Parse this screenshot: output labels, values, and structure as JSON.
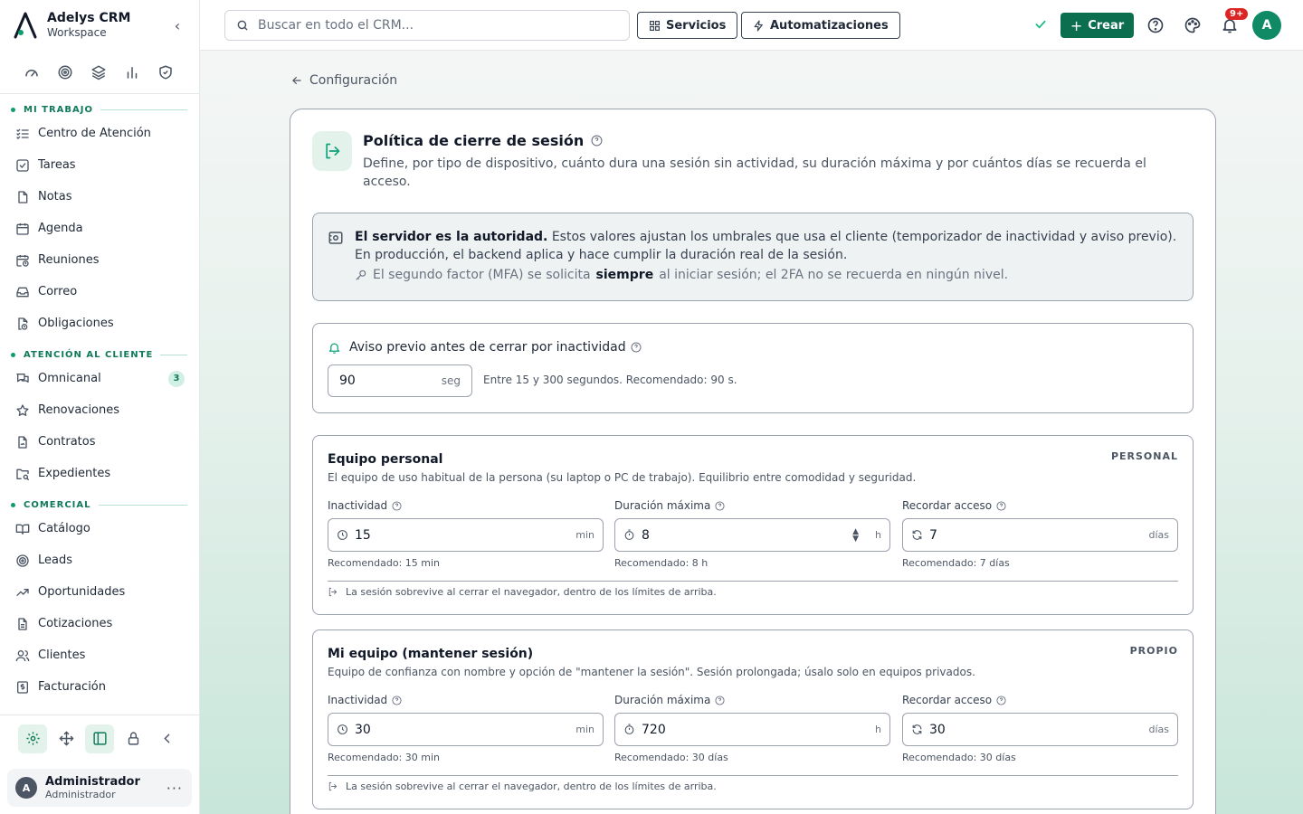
{
  "brand": {
    "app_name": "Adelys CRM",
    "workspace": "Workspace"
  },
  "sidebar": {
    "quick_icons": [
      "speedometer-icon",
      "target-icon",
      "layers-icon",
      "bar-chart-icon",
      "shield-icon"
    ],
    "sections": [
      {
        "title": "MI TRABAJO",
        "items": [
          {
            "label": "Centro de Atención",
            "icon": "list-check-icon"
          },
          {
            "label": "Tareas",
            "icon": "checkbox-icon"
          },
          {
            "label": "Notas",
            "icon": "note-icon"
          },
          {
            "label": "Agenda",
            "icon": "calendar-icon"
          },
          {
            "label": "Reuniones",
            "icon": "calendar-clock-icon"
          },
          {
            "label": "Correo",
            "icon": "inbox-icon"
          },
          {
            "label": "Obligaciones",
            "icon": "file-clock-icon"
          }
        ]
      },
      {
        "title": "ATENCIÓN AL CLIENTE",
        "items": [
          {
            "label": "Omnicanal",
            "icon": "chat-icon",
            "badge": "3"
          },
          {
            "label": "Renovaciones",
            "icon": "star-icon"
          },
          {
            "label": "Contratos",
            "icon": "file-signature-icon"
          },
          {
            "label": "Expedientes",
            "icon": "folder-search-icon"
          }
        ]
      },
      {
        "title": "COMERCIAL",
        "items": [
          {
            "label": "Catálogo",
            "icon": "book-icon"
          },
          {
            "label": "Leads",
            "icon": "target-icon"
          },
          {
            "label": "Oportunidades",
            "icon": "trend-up-icon"
          },
          {
            "label": "Cotizaciones",
            "icon": "file-text-icon"
          },
          {
            "label": "Clientes",
            "icon": "users-icon"
          },
          {
            "label": "Facturación",
            "icon": "dollar-file-icon"
          }
        ]
      }
    ],
    "tools": [
      "settings-icon",
      "move-icon",
      "panel-icon",
      "lock-icon",
      "chevron-left-icon"
    ],
    "user": {
      "initial": "A",
      "name": "Administrador",
      "role": "Administrador"
    }
  },
  "topbar": {
    "search_placeholder": "Buscar en todo el CRM...",
    "services_label": "Servicios",
    "automations_label": "Automatizaciones",
    "create_label": "Crear",
    "notif_count": "9+",
    "avatar_initial": "A"
  },
  "page": {
    "back_label": "Configuración",
    "title": "Política de cierre de sesión",
    "description": "Define, por tipo de dispositivo, cuánto dura una sesión sin actividad, su duración máxima y por cuántos días se recuerda el acceso.",
    "info": {
      "bold": "El servidor es la autoridad.",
      "text": " Estos valores ajustan los umbrales que usa el cliente (temporizador de inactividad y aviso previo). En producción, el backend aplica y hace cumplir la duración real de la sesión.",
      "mfa_pre": "El segundo factor (MFA) se solicita",
      "mfa_bold": "siempre",
      "mfa_post": "al iniciar sesión; el 2FA no se recuerda en ningún nivel."
    },
    "warning": {
      "label": "Aviso previo antes de cerrar por inactividad",
      "value": "90",
      "unit": "seg",
      "hint": "Entre 15 y 300 segundos. Recomendado: 90 s."
    },
    "devices": [
      {
        "name": "Equipo personal",
        "tag": "PERSONAL",
        "description": "El equipo de uso habitual de la persona (su laptop o PC de trabajo). Equilibrio entre comodidad y seguridad.",
        "inactivity": {
          "label": "Inactividad",
          "value": "15",
          "unit": "min",
          "rec": "Recomendado: 15 min"
        },
        "max_duration": {
          "label": "Duración máxima",
          "value": "8",
          "unit": "h",
          "rec": "Recomendado: 8 h"
        },
        "remember": {
          "label": "Recordar acceso",
          "value": "7",
          "unit": "días",
          "rec": "Recomendado: 7 días"
        },
        "note": "La sesión sobrevive al cerrar el navegador, dentro de los límites de arriba."
      },
      {
        "name": "Mi equipo (mantener sesión)",
        "tag": "PROPIO",
        "description": "Equipo de confianza con nombre y opción de \"mantener la sesión\". Sesión prolongada; úsalo solo en equipos privados.",
        "inactivity": {
          "label": "Inactividad",
          "value": "30",
          "unit": "min",
          "rec": "Recomendado: 30 min"
        },
        "max_duration": {
          "label": "Duración máxima",
          "value": "720",
          "unit": "h",
          "rec": "Recomendado: 30 días"
        },
        "remember": {
          "label": "Recordar acceso",
          "value": "30",
          "unit": "días",
          "rec": "Recomendado: 30 días"
        },
        "note": "La sesión sobrevive al cerrar el navegador, dentro de los límites de arriba."
      }
    ]
  },
  "colors": {
    "accent": "#0b6e4f",
    "section": "#0f7a5a",
    "badge_bg": "#d1efe3",
    "notif": "#dc2626"
  }
}
